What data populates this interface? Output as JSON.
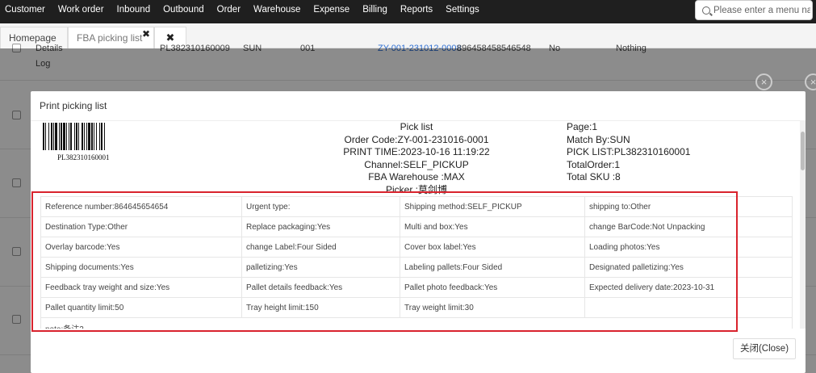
{
  "nav": [
    "Customer",
    "Work order",
    "Inbound",
    "Outbound",
    "Order",
    "Warehouse",
    "Expense",
    "Billing",
    "Reports",
    "Settings"
  ],
  "search": {
    "placeholder": "Please enter a menu na"
  },
  "tabs": {
    "home": "Homepage",
    "fba": "FBA picking list",
    "close_glyph": "✖"
  },
  "background": {
    "details": "Details",
    "log": "Log",
    "pick_list_no": "PL382310160009",
    "match": "SUN",
    "code": "001",
    "order_link": "ZY-001-231012-0008",
    "reference": "896458458546548",
    "flag": "No",
    "nothing": "Nothing"
  },
  "modal": {
    "title": "Print picking list",
    "barcode_text": "PL382310160001",
    "center": {
      "pick_list": "Pick list",
      "order_code": "Order Code:ZY-001-231016-0001",
      "print_time": "PRINT TIME:2023-10-16 11:19:22",
      "channel": "Channel:SELF_PICKUP",
      "fba_warehouse": "FBA Warehouse :MAX",
      "picker": "Picker :莫剑博"
    },
    "right": {
      "page": "Page:1",
      "match_by": "Match By:SUN",
      "pick_list": "PICK LIST:PL382310160001",
      "total_order": "TotalOrder:1",
      "total_sku": "Total SKU :8"
    },
    "details": [
      [
        "Reference number:864645654654",
        "Urgent type:",
        "Shipping method:SELF_PICKUP",
        "shipping to:Other"
      ],
      [
        "Destination Type:Other",
        "Replace packaging:Yes",
        "Multi and box:Yes",
        "change BarCode:Not Unpacking"
      ],
      [
        "Overlay barcode:Yes",
        "change Label:Four Sided",
        "Cover box label:Yes",
        "Loading photos:Yes"
      ],
      [
        "Shipping documents:Yes",
        "palletizing:Yes",
        "Labeling pallets:Four Sided",
        "Designated palletizing:Yes"
      ],
      [
        "Feedback tray weight and size:Yes",
        "Pallet details feedback:Yes",
        "Pallet photo feedback:Yes",
        "Expected delivery date:2023-10-31"
      ],
      [
        "Pallet quantity limit:50",
        "Tray height limit:150",
        "Tray weight limit:30",
        ""
      ]
    ],
    "note": "note:备注2",
    "close_button": "关闭(Close)",
    "overlay_close_glyph": "×"
  },
  "colors": {
    "highlight": "#d9232d",
    "nav_bg": "#1f1f1f",
    "link": "#2f6fd1"
  }
}
